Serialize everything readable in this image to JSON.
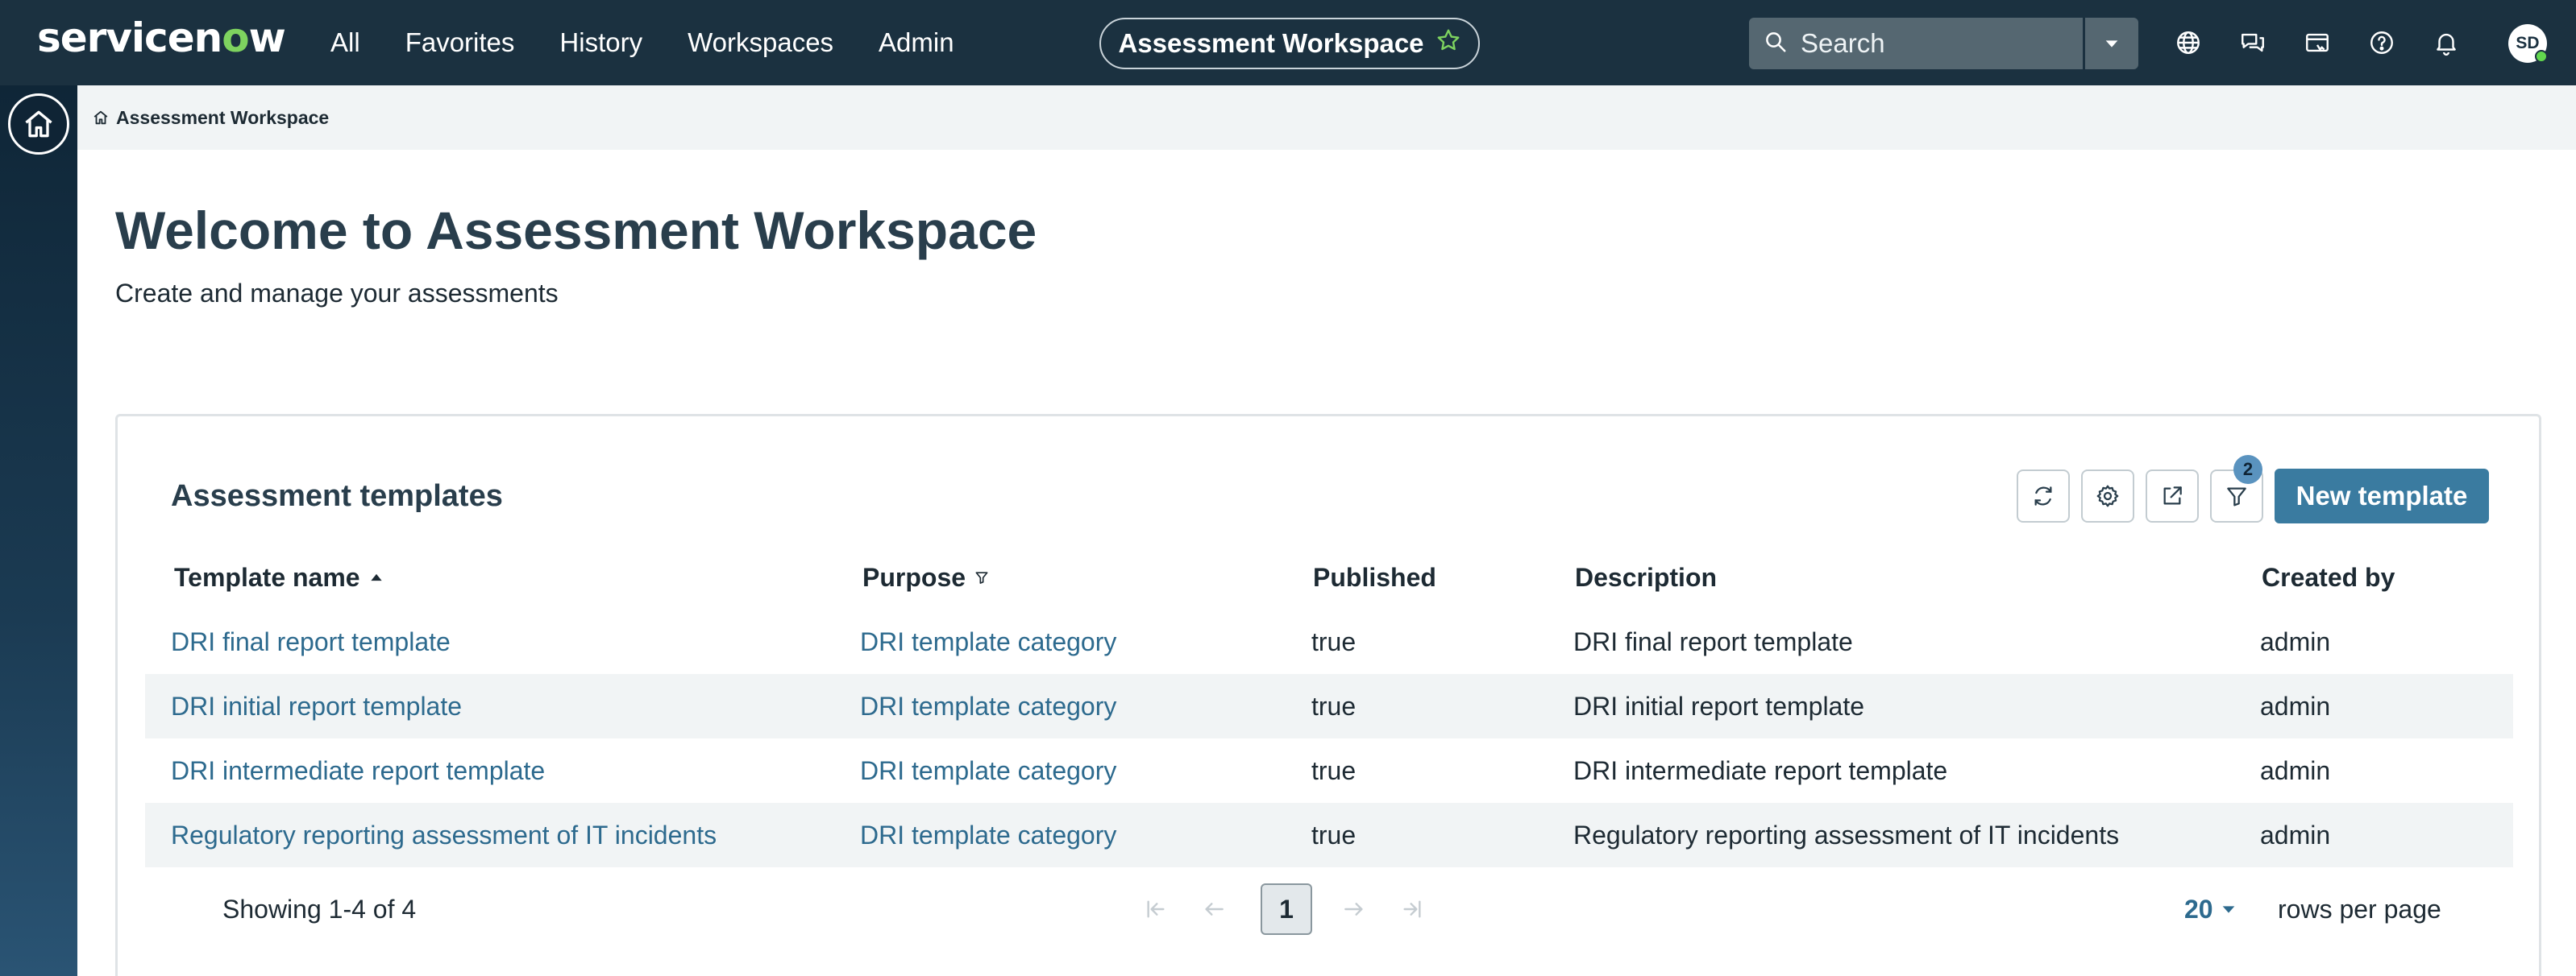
{
  "topnav": {
    "logo_text_pre": "servicen",
    "logo_text_o": "o",
    "logo_text_post": "w",
    "items": [
      "All",
      "Favorites",
      "History",
      "Workspaces",
      "Admin"
    ],
    "workspace_pill": "Assessment Workspace",
    "search_placeholder": "Search",
    "icons": [
      "globe-icon",
      "chat-icon",
      "ticket-icon",
      "help-icon",
      "bell-icon"
    ],
    "avatar_initials": "SD",
    "colors": {
      "bar": "#1b3140",
      "logo_accent": "#7ed35f",
      "status_online": "#62d84e"
    }
  },
  "breadcrumb": {
    "label": "Assessment Workspace"
  },
  "page": {
    "title": "Welcome to Assessment Workspace",
    "subtitle": "Create and manage your assessments"
  },
  "card": {
    "title": "Assessment templates",
    "filter_count": "2",
    "new_button": "New template",
    "columns": [
      "Template name",
      "Purpose",
      "Published",
      "Description",
      "Created by"
    ],
    "rows": [
      [
        "DRI final report template",
        "DRI template category",
        "true",
        "DRI final report template",
        "admin"
      ],
      [
        "DRI initial report template",
        "DRI template category",
        "true",
        "DRI initial report template",
        "admin"
      ],
      [
        "DRI intermediate report template",
        "DRI template category",
        "true",
        "DRI intermediate report template",
        "admin"
      ],
      [
        "Regulatory reporting assessment of IT incidents",
        "DRI template category",
        "true",
        "Regulatory reporting assessment of IT incidents",
        "admin"
      ]
    ],
    "footer": {
      "showing": "Showing 1-4 of 4",
      "page": "1",
      "rows_per_page_value": "20",
      "rows_per_page_label": "rows per page"
    },
    "colors": {
      "link": "#2d6a8e",
      "button": "#3a7ba0",
      "row_alt": "#f1f4f5"
    }
  }
}
